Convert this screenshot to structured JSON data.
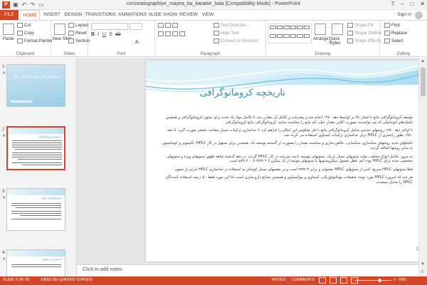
{
  "window": {
    "title": "coromatographiye_mayea_ba_karaeie_bala [Compatibility Mode] - PowerPoint",
    "app_badge": "P",
    "controls": [
      "?",
      "–",
      "□",
      "✕"
    ]
  },
  "tabs": [
    {
      "label": "FILE"
    },
    {
      "label": "HOME",
      "active": true
    },
    {
      "label": "INSERT"
    },
    {
      "label": "DESIGN"
    },
    {
      "label": "TRANSITIONS"
    },
    {
      "label": "ANIMATIONS"
    },
    {
      "label": "SLIDE SHOW"
    },
    {
      "label": "REVIEW"
    },
    {
      "label": "VIEW"
    }
  ],
  "signin": "Sign in",
  "ribbon": {
    "clipboard": {
      "paste": "Paste",
      "cut": "Cut",
      "copy": "Copy",
      "format_painter": "Format Painter",
      "label": "Clipboard"
    },
    "slides": {
      "new_slide": "New Slide",
      "layout": "Layout",
      "reset": "Reset",
      "section": "Section",
      "label": "Slides"
    },
    "font": {
      "label": "Font"
    },
    "paragraph": {
      "text_direction": "Text Direction",
      "align_text": "Align Text",
      "smartart": "Convert to SmartArt",
      "label": "Paragraph"
    },
    "drawing": {
      "arrange": "Arrange",
      "quick_styles": "Quick Styles",
      "shape_fill": "Shape Fill",
      "shape_outline": "Shape Outline",
      "shape_effects": "Shape Effects",
      "label": "Drawing"
    },
    "editing": {
      "find": "Find",
      "replace": "Replace",
      "select": "Select",
      "label": "Editing"
    }
  },
  "thumbnails": [
    {
      "num": "1",
      "title": "کروماتوگرافی مایع با کارایی بالا"
    },
    {
      "num": "2",
      "title": "تاریخچه کروماتوگرافی",
      "selected": true
    },
    {
      "num": "3",
      "title": "کروماتوگرافی مایع"
    },
    {
      "num": "4",
      "title": "جداسازی بر اساس"
    }
  ],
  "slide": {
    "title": "تاریخچه کروماتوگرافی",
    "paragraphs": [
      "توسعه کروماتوگرافی مایع با فشار بالا بر اواسط دهه ۱۹۷۰ انجام شد و پیشرفت و تکامل آن مقارن شد با تکامل مواد پک شده برای ستون کروماتوگرافی و همچنین تکنیک‌های اتوماتیکی که می توانستند بصورت آنلاین مقدار خیلی کم مایع را محاسبه نمایند. کروماتوگرافی مایع کروماتوگرافی",
      "تا اواخر دهه ۱۹۷۰ روشهای جدیدی شامل کروماتوگرافی مایع با فاز معکوس این امکان را فراهم کرد تا جداسازی ترکیبات بسیار مشابه، دقیقتر صورت گیرد. تا دهه ۱۹۸۰ بطور رایجتری از HPLC برای جداسازی ترکیبات کیمیاوی استفاده می کرده شد.",
      "تکنیکهای جدید روشهای جداسازی، شناسایی، خالص سازی و محاسبه مقدار را مفتوزت از گذشته توسعه داد. همچنین برای تسهیل در کار HPLC، کامپیوتر و اتوماسیون به سایر روشها اضافه گردید.",
      "به مرور، تکامل انواع مختلف، تولید ستونهای بسیار باریک، ستونهای پیوسته باعث سرعت در کار HPLC گردید. در دهه گذشته شاهد ظهور ستونهای ویژه و ستونهای تخصصی شده برای HPLC بوده ایم. قطر معمول میکروستونها یا ستونهای موئینه از یک میکرو تا ۳ mm تا ۲۰۰ μm است.",
      "فعلا ستونهای HPLC سریع، کمتر از ستونهای HPLC معمولی و برابر ۳ mm است و در بعضیهای بسیار کوچکتر به استفاده در جداسازی HPLC جزئی از ستون.",
      "هر چند که امروزه HPLC مورد توجه تحقیقات بیوتکنولوژیکی، کیمیاوی و بیوکیمیاوی و همچنین صنایع دارو سازی است اما این مورد فقط ۵۰ درصد استفاده کننده‌گان HPLC را شامل میشدند."
    ],
    "number": "2"
  },
  "notes_placeholder": "Click to add notes",
  "status": {
    "slide_counter": "SLIDE 2 OF 30",
    "language": "ENGLISH (UNITED STATES)",
    "notes": "NOTES",
    "comments": "COMMENTS",
    "zoom": "70%"
  }
}
